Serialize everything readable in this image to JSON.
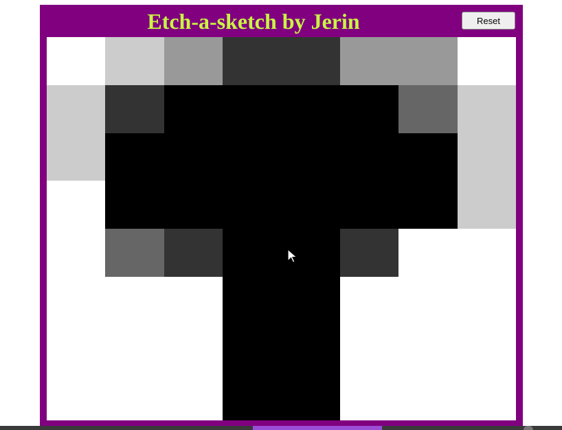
{
  "app": {
    "title": "Etch-a-sketch by Jerin",
    "reset_label": "Reset"
  },
  "grid": {
    "columns": 8,
    "rows": 8,
    "cells": [
      [
        "#ffffff",
        "#cccccc",
        "#999999",
        "#333333",
        "#333333",
        "#999999",
        "#999999",
        "#ffffff"
      ],
      [
        "#cccccc",
        "#333333",
        "#000000",
        "#000000",
        "#000000",
        "#000000",
        "#666666",
        "#cccccc"
      ],
      [
        "#cccccc",
        "#000000",
        "#000000",
        "#000000",
        "#000000",
        "#000000",
        "#000000",
        "#cccccc"
      ],
      [
        "#ffffff",
        "#000000",
        "#000000",
        "#000000",
        "#000000",
        "#000000",
        "#000000",
        "#cccccc"
      ],
      [
        "#ffffff",
        "#666666",
        "#333333",
        "#000000",
        "#000000",
        "#333333",
        "#ffffff",
        "#ffffff"
      ],
      [
        "#ffffff",
        "#ffffff",
        "#ffffff",
        "#000000",
        "#000000",
        "#ffffff",
        "#ffffff",
        "#ffffff"
      ],
      [
        "#ffffff",
        "#ffffff",
        "#ffffff",
        "#000000",
        "#000000",
        "#ffffff",
        "#ffffff",
        "#ffffff"
      ],
      [
        "#ffffff",
        "#ffffff",
        "#ffffff",
        "#000000",
        "#000000",
        "#ffffff",
        "#ffffff",
        "#ffffff"
      ]
    ]
  },
  "colors": {
    "frame": "#800080",
    "title": "#c8f542",
    "taskbar_accent": "#9b4fd6"
  },
  "icons": {
    "cursor": "mouse-pointer-icon"
  }
}
